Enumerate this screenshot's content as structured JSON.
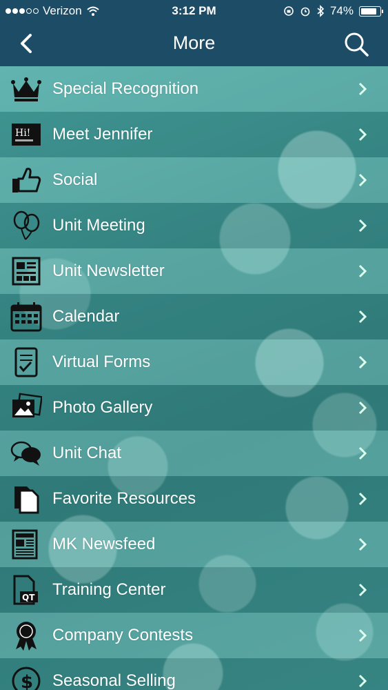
{
  "status_bar": {
    "carrier": "Verizon",
    "time": "3:12 PM",
    "battery": "74%",
    "battery_level": 0.74,
    "signal_bars": 3
  },
  "nav": {
    "title": "More",
    "back_icon": "chevron-left-icon",
    "search_icon": "search-icon"
  },
  "menu": {
    "items": [
      {
        "label": "Special Recognition",
        "icon": "crown-icon"
      },
      {
        "label": "Meet Jennifer",
        "icon": "hi-name-tag-icon"
      },
      {
        "label": "Social",
        "icon": "thumbs-up-icon"
      },
      {
        "label": "Unit Meeting",
        "icon": "balloons-icon"
      },
      {
        "label": "Unit Newsletter",
        "icon": "newsletter-icon"
      },
      {
        "label": "Calendar",
        "icon": "calendar-icon"
      },
      {
        "label": "Virtual Forms",
        "icon": "checklist-icon"
      },
      {
        "label": "Photo Gallery",
        "icon": "photos-icon"
      },
      {
        "label": "Unit Chat",
        "icon": "chat-bubbles-icon"
      },
      {
        "label": "Favorite Resources",
        "icon": "documents-icon"
      },
      {
        "label": "MK Newsfeed",
        "icon": "newspaper-icon"
      },
      {
        "label": "Training Center",
        "icon": "qt-document-icon"
      },
      {
        "label": "Company Contests",
        "icon": "award-ribbon-icon"
      },
      {
        "label": "Seasonal Selling",
        "icon": "dollar-icon"
      }
    ]
  },
  "colors": {
    "bar": "#1d4d66",
    "background": "#3f8f8c",
    "text": "#ffffff"
  }
}
